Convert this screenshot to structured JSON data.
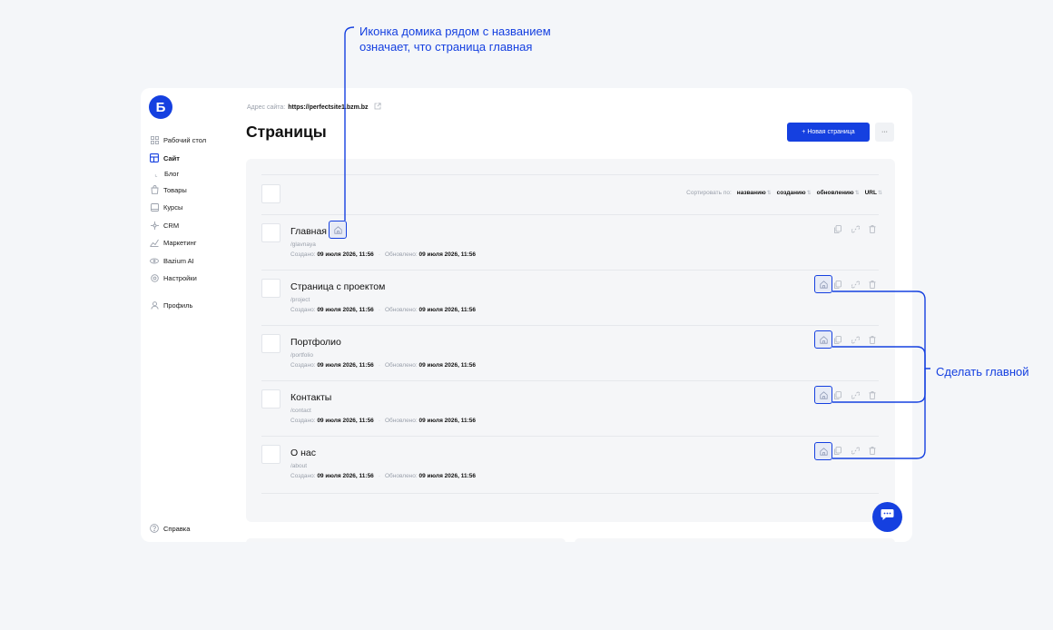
{
  "sidebar": {
    "logo_letter": "Б",
    "items": [
      {
        "label": "Рабочий стол",
        "icon": "grid-icon"
      },
      {
        "label": "Сайт",
        "icon": "layout-icon"
      },
      {
        "label": "Блог",
        "icon": "sub-arrow-icon"
      },
      {
        "label": "Товары",
        "icon": "bag-icon"
      },
      {
        "label": "Курсы",
        "icon": "book-icon"
      },
      {
        "label": "CRM",
        "icon": "crm-icon"
      },
      {
        "label": "Маркетинг",
        "icon": "chart-icon"
      },
      {
        "label": "Bazium AI",
        "icon": "ai-icon"
      },
      {
        "label": "Настройки",
        "icon": "gear-icon"
      },
      {
        "label": "Профиль",
        "icon": "user-icon"
      }
    ],
    "help_label": "Справка"
  },
  "header": {
    "site_address_label": "Адрес сайта:",
    "site_address_value": "https://perfectsite1.bzm.bz",
    "title": "Страницы",
    "new_page_label": "+ Новая страница",
    "more_label": "···"
  },
  "sort": {
    "label": "Сортировать по:",
    "options": [
      "названию",
      "созданию",
      "обновлению",
      "URL"
    ],
    "arrow": "⇅"
  },
  "pages": [
    {
      "title": "Главная",
      "slug": "/glavnaya",
      "created_label": "Создано:",
      "created": "09 июля 2026, 11:56",
      "updated_label": "Обновлено:",
      "updated": "09 июля 2026, 11:56",
      "is_home": true
    },
    {
      "title": "Страница с проектом",
      "slug": "/project",
      "created_label": "Создано:",
      "created": "09 июля 2026, 11:56",
      "updated_label": "Обновлено:",
      "updated": "09 июля 2026, 11:56",
      "is_home": false
    },
    {
      "title": "Портфолио",
      "slug": "/portfolio",
      "created_label": "Создано:",
      "created": "09 июля 2026, 11:56",
      "updated_label": "Обновлено:",
      "updated": "09 июля 2026, 11:56",
      "is_home": false
    },
    {
      "title": "Контакты",
      "slug": "/contact",
      "created_label": "Создано:",
      "created": "09 июля 2026, 11:56",
      "updated_label": "Обновлено:",
      "updated": "09 июля 2026, 11:56",
      "is_home": false
    },
    {
      "title": "О нас",
      "slug": "/about",
      "created_label": "Создано:",
      "created": "09 июля 2026, 11:56",
      "updated_label": "Обновлено:",
      "updated": "09 июля 2026, 11:56",
      "is_home": false
    }
  ],
  "annotations": {
    "home_icon_note_line1": "Иконка домика рядом с названием",
    "home_icon_note_line2": "означает, что страница главная",
    "make_home_note": "Сделать главной"
  },
  "colors": {
    "accent": "#1540e0",
    "bg": "#f4f6f9",
    "panel": "#f5f6f8",
    "muted": "#9aa0ab"
  }
}
